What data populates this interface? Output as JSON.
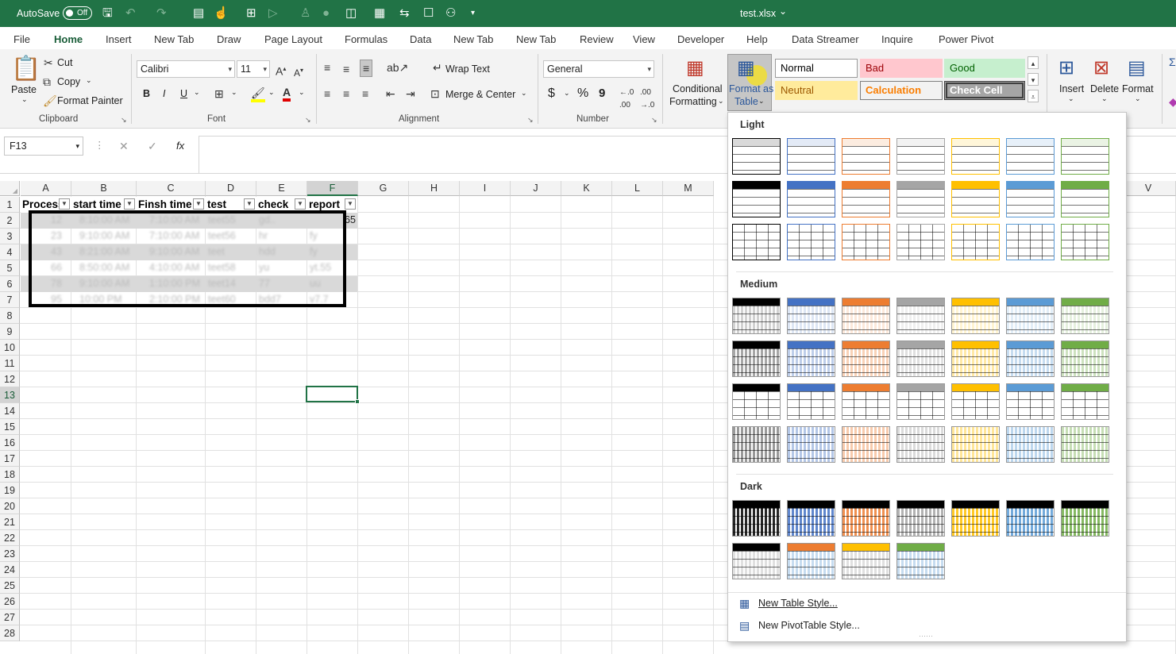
{
  "titlebar": {
    "autosave_label": "AutoSave",
    "autosave_state": "Off",
    "filename": "test.xlsx",
    "filename_caret": "⌄",
    "bg_color": "#217346"
  },
  "menu": {
    "tabs": [
      "File",
      "Home",
      "Insert",
      "New Tab",
      "Draw",
      "Page Layout",
      "Formulas",
      "Data",
      "New Tab",
      "New Tab",
      "Review",
      "View",
      "Developer",
      "Help",
      "Data Streamer",
      "Inquire",
      "Power Pivot"
    ],
    "active": "Home"
  },
  "ribbon": {
    "clipboard": {
      "paste": "Paste",
      "cut": "Cut",
      "copy": "Copy",
      "format_painter": "Format Painter",
      "group": "Clipboard"
    },
    "font": {
      "name": "Calibri",
      "size": "11",
      "bold": "B",
      "italic": "I",
      "underline": "U",
      "group": "Font"
    },
    "alignment": {
      "wrap": "Wrap Text",
      "merge": "Merge & Center",
      "group": "Alignment"
    },
    "number": {
      "format": "General",
      "currency": "$",
      "percent": "%",
      "comma": "9",
      "group": "Number"
    },
    "styles": {
      "conditional_line1": "Conditional",
      "conditional_line2": "Formatting",
      "format_table_line1": "Format as",
      "format_table_line2": "Table",
      "cells": [
        {
          "label": "Normal",
          "bg": "#ffffff",
          "fg": "#000000",
          "border": "#9a9a9a"
        },
        {
          "label": "Bad",
          "bg": "#ffc7ce",
          "fg": "#9c0006",
          "border": "#ffc7ce"
        },
        {
          "label": "Good",
          "bg": "#c6efce",
          "fg": "#006100",
          "border": "#c6efce"
        },
        {
          "label": "Neutral",
          "bg": "#ffeb9c",
          "fg": "#9c5700",
          "border": "#ffeb9c"
        },
        {
          "label": "Calculation",
          "bg": "#f2f2f2",
          "fg": "#fa7d00",
          "border": "#7f7f7f"
        },
        {
          "label": "Check Cell",
          "bg": "#a5a5a5",
          "fg": "#ffffff",
          "border": "#3f3f3f"
        }
      ]
    },
    "cells_group": {
      "insert": "Insert",
      "delete": "Delete",
      "format": "Format"
    }
  },
  "formula_bar": {
    "name_box": "F13",
    "cancel": "✕",
    "enter": "✓",
    "fx": "fx",
    "value": ""
  },
  "sheet": {
    "columns": [
      "A",
      "B",
      "C",
      "D",
      "E",
      "F",
      "G",
      "H",
      "I",
      "J",
      "K",
      "L",
      "M",
      "V"
    ],
    "rows": [
      "1",
      "2",
      "3",
      "4",
      "5",
      "6",
      "7",
      "8",
      "9",
      "10",
      "11",
      "12",
      "13",
      "14",
      "15",
      "16",
      "17",
      "18",
      "19",
      "20",
      "21",
      "22",
      "23",
      "24",
      "25",
      "26",
      "27",
      "28"
    ],
    "headers": [
      "Process",
      "start time",
      "Finsh time",
      "test",
      "check",
      "report"
    ],
    "visible_value_F2": "65",
    "blurred_rows": [
      [
        "12",
        "8:10:00 AM",
        "7:10:00 AM",
        "teet55",
        "gd..",
        ""
      ],
      [
        "23",
        "9:10:00 AM",
        "7:10:00 AM",
        "teet56",
        "hr",
        "fy"
      ],
      [
        "43",
        "8:21:00 AM",
        "9:10:00 AM",
        "teet",
        "hdd",
        "fy"
      ],
      [
        "66",
        "8:50:00 AM",
        "4:10:00 AM",
        "teet58",
        "yu",
        "yt.55"
      ],
      [
        "78",
        "9:10:00 AM",
        "1:10:00 PM",
        "teet14",
        "77",
        "uu"
      ],
      [
        "95",
        "10:00 PM",
        "2:10:00 PM",
        "teet60",
        "bdd7",
        "v7.7"
      ]
    ],
    "selected_cell": "F13"
  },
  "gallery": {
    "sections": [
      "Light",
      "Medium",
      "Dark"
    ],
    "palette": [
      "#000000",
      "#4472c4",
      "#ed7d31",
      "#a5a5a5",
      "#ffc000",
      "#5b9bd5",
      "#70ad47"
    ],
    "new_table_style": "New Table Style...",
    "new_pivot_style": "New PivotTable Style..."
  }
}
